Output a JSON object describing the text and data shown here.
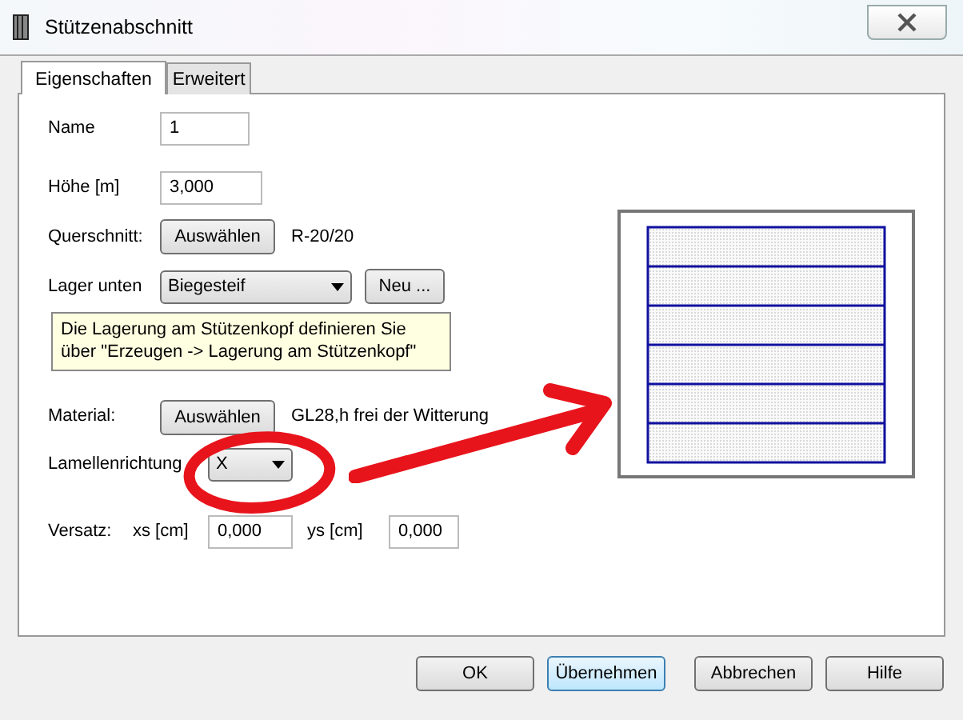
{
  "window": {
    "title": "Stützenabschnitt"
  },
  "tabs": [
    {
      "label": "Eigenschaften",
      "selected": true
    },
    {
      "label": "Erweitert",
      "selected": false
    }
  ],
  "name": {
    "label": "Name",
    "value": "1"
  },
  "hoehe": {
    "label": "Höhe [m]",
    "value": "3,000"
  },
  "querschnitt": {
    "label": "Querschnitt:",
    "button": "Auswählen",
    "value": "R-20/20"
  },
  "lager_unten": {
    "label": "Lager unten",
    "value": "Biegesteif",
    "button": "Neu ..."
  },
  "info": "Die Lagerung am Stützenkopf definieren Sie über \"Erzeugen -> Lagerung am Stützenkopf\"",
  "material": {
    "label": "Material:",
    "button": "Auswählen",
    "value": "GL28,h frei der Witterung"
  },
  "lamellenrichtung": {
    "label": "Lamellenrichtung",
    "value": "X"
  },
  "versatz": {
    "label": "Versatz:",
    "xs_label": "xs [cm]",
    "xs": "0,000",
    "ys_label": "ys [cm]",
    "ys": "0,000"
  },
  "buttons": [
    {
      "label": "OK",
      "selected": false
    },
    {
      "label": "Übernehmen",
      "selected": true
    },
    {
      "label": "Abbrechen",
      "selected": false
    },
    {
      "label": "Hilfe",
      "selected": false
    }
  ]
}
